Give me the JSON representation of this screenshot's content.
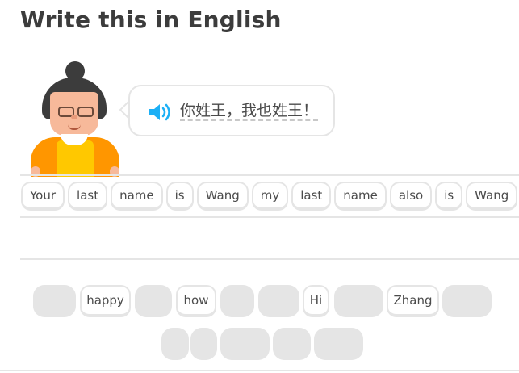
{
  "header": {
    "title": "Write this in English"
  },
  "prompt": {
    "sentence": "你姓王，我也姓王！",
    "speaker_icon": "speaker-icon"
  },
  "answer": {
    "words": [
      "Your",
      "last",
      "name",
      "is",
      "Wang",
      "my",
      "last",
      "name",
      "also",
      "is",
      "Wang"
    ]
  },
  "word_bank": {
    "words": [
      "happy",
      "how",
      "Hi",
      "Zhang"
    ]
  },
  "colors": {
    "accent_blue": "#1cb0f6",
    "border": "#e5e5e5",
    "orange": "#ff9600",
    "yellow": "#ffc800"
  }
}
